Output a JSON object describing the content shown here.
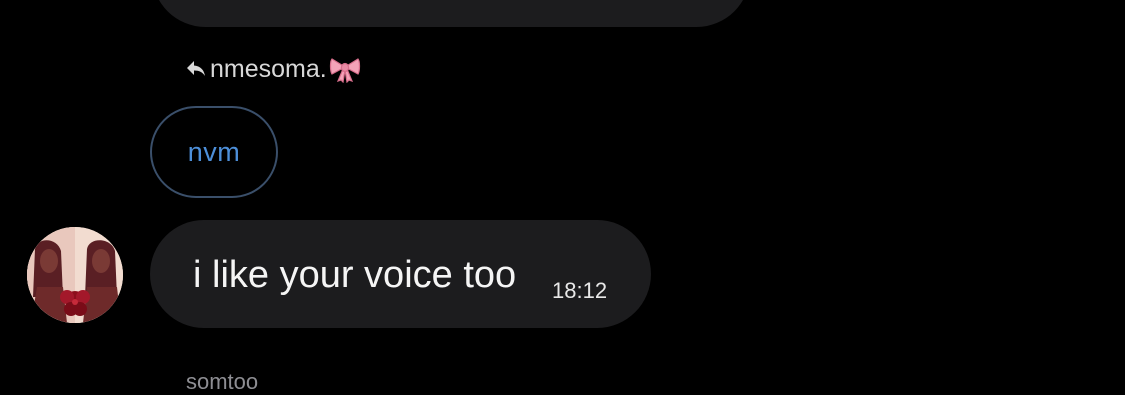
{
  "reply": {
    "sender_name": "nmesoma.",
    "emoji_name": "ribbon-bow",
    "quoted_text": "nvm"
  },
  "message": {
    "text": "i like your voice too",
    "time": "18:12"
  },
  "next_message": {
    "sender_name": "somtoo"
  },
  "colors": {
    "background": "#000000",
    "bubble": "#1c1c1e",
    "quoted_text": "#4d8fd9",
    "quoted_border": "#3a4f6a",
    "secondary_text": "#8e8e93"
  }
}
